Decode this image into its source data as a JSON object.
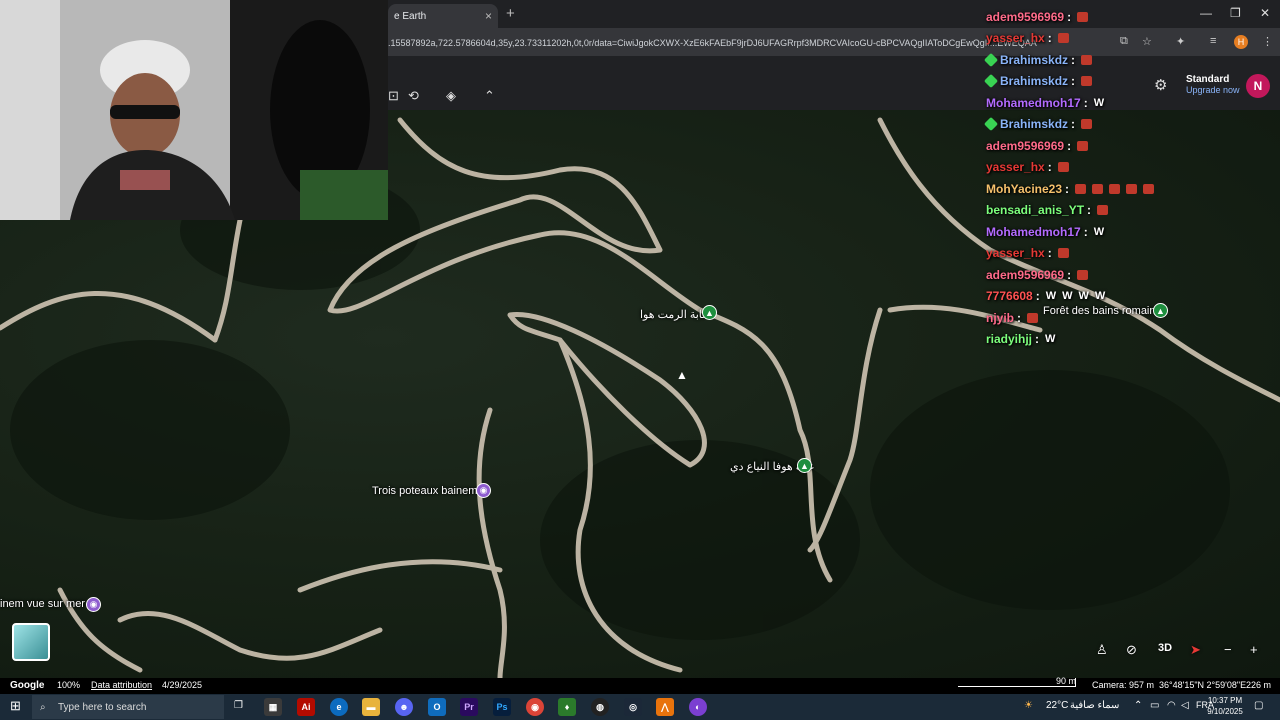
{
  "browser": {
    "tab_title": "e Earth",
    "tab_close": "×",
    "new_tab": "+",
    "url": ".15587892a,722.5786604d,35y,23.73311202h,0t,0r/data=CiwiJgokCXWX-XzE6kFAEbF9jrDJ6UFAGRrpf3MDRCVAIcoGU-cBPCVAQgIIAToDCgEwQgII...EWEQAA",
    "window_controls": {
      "minimize": "—",
      "maximize": "❐",
      "close": "✕"
    },
    "profile_initial": "H"
  },
  "ge": {
    "plan_title": "Standard",
    "plan_sub": "Upgrade now",
    "user_initial": "N"
  },
  "map": {
    "labels": {
      "trois_poteaux": "Trois poteaux bainem",
      "foret_bains": "Forêt des bains romain",
      "arabic_1": "غابة الرمت هوا",
      "arabic_2": "غابة هوفا النياع دي",
      "vue_sur_mer": "inem vue sur mer"
    }
  },
  "chat": [
    {
      "user": "adem9596969",
      "color": "#ff6b8a",
      "badge": false,
      "emotes": 1,
      "w": 0
    },
    {
      "user": "yasser_hx",
      "color": "#e53935",
      "badge": false,
      "emotes": 1,
      "w": 0
    },
    {
      "user": "Brahimskdz",
      "color": "#8ab4f8",
      "badge": true,
      "emotes": 1,
      "w": 0
    },
    {
      "user": "Brahimskdz",
      "color": "#8ab4f8",
      "badge": true,
      "emotes": 1,
      "w": 0
    },
    {
      "user": "Mohamedmoh17",
      "color": "#b36bff",
      "badge": false,
      "emotes": 0,
      "w": 1
    },
    {
      "user": "Brahimskdz",
      "color": "#8ab4f8",
      "badge": true,
      "emotes": 1,
      "w": 0
    },
    {
      "user": "adem9596969",
      "color": "#ff6b8a",
      "badge": false,
      "emotes": 1,
      "w": 0
    },
    {
      "user": "yasser_hx",
      "color": "#e53935",
      "badge": false,
      "emotes": 1,
      "w": 0
    },
    {
      "user": "MohYacine23",
      "color": "#f5c16c",
      "badge": false,
      "emotes": 5,
      "w": 0
    },
    {
      "user": "bensadi_anis_YT",
      "color": "#7dff7d",
      "badge": false,
      "emotes": 1,
      "w": 0
    },
    {
      "user": "Mohamedmoh17",
      "color": "#b36bff",
      "badge": false,
      "emotes": 0,
      "w": 1
    },
    {
      "user": "yasser_hx",
      "color": "#e53935",
      "badge": false,
      "emotes": 1,
      "w": 0
    },
    {
      "user": "adem9596969",
      "color": "#ff6b8a",
      "badge": false,
      "emotes": 1,
      "w": 0
    },
    {
      "user": "7776608",
      "color": "#ff5252",
      "badge": false,
      "emotes": 0,
      "w": 4
    },
    {
      "user": "njyib",
      "color": "#ff6b8a",
      "badge": false,
      "emotes": 1,
      "w": 0
    },
    {
      "user": "riadyihjj",
      "color": "#7dff7d",
      "badge": false,
      "emotes": 0,
      "w": 1
    }
  ],
  "chat_sep": ":",
  "chat_w": "W",
  "map_controls": {
    "three_d": "3D",
    "zoom_out": "−",
    "zoom_in": "+"
  },
  "status": {
    "brand": "Google",
    "zoom": "100%",
    "attribution": "Data attribution",
    "date": "4/29/2025",
    "scale": "90 m",
    "camera": "Camera: 957 m",
    "coords": "36°48'15\"N 2°59'08\"E",
    "elevation": "226 m"
  },
  "taskbar": {
    "search_placeholder": "Type here to search",
    "weather": "22°C",
    "weather_text": "سماء صافية",
    "language": "FRA",
    "time": "10:37 PM",
    "date": "9/10/2025"
  }
}
